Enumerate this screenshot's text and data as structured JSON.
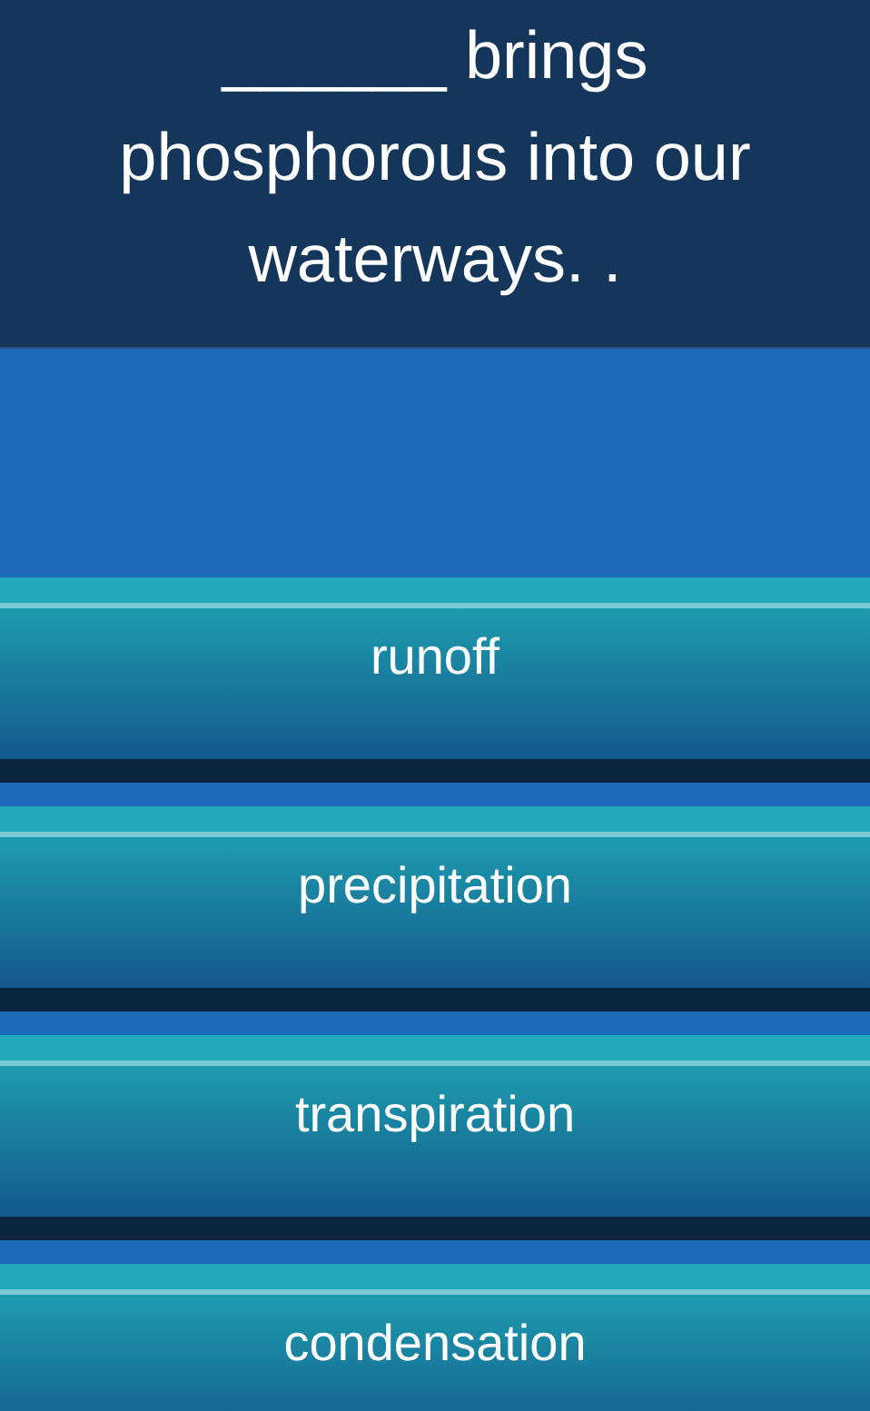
{
  "question": {
    "text": "______ brings phosphorous into our waterways. ."
  },
  "answers": [
    {
      "label": "runoff"
    },
    {
      "label": "precipitation"
    },
    {
      "label": "transpiration"
    },
    {
      "label": "condensation"
    }
  ]
}
